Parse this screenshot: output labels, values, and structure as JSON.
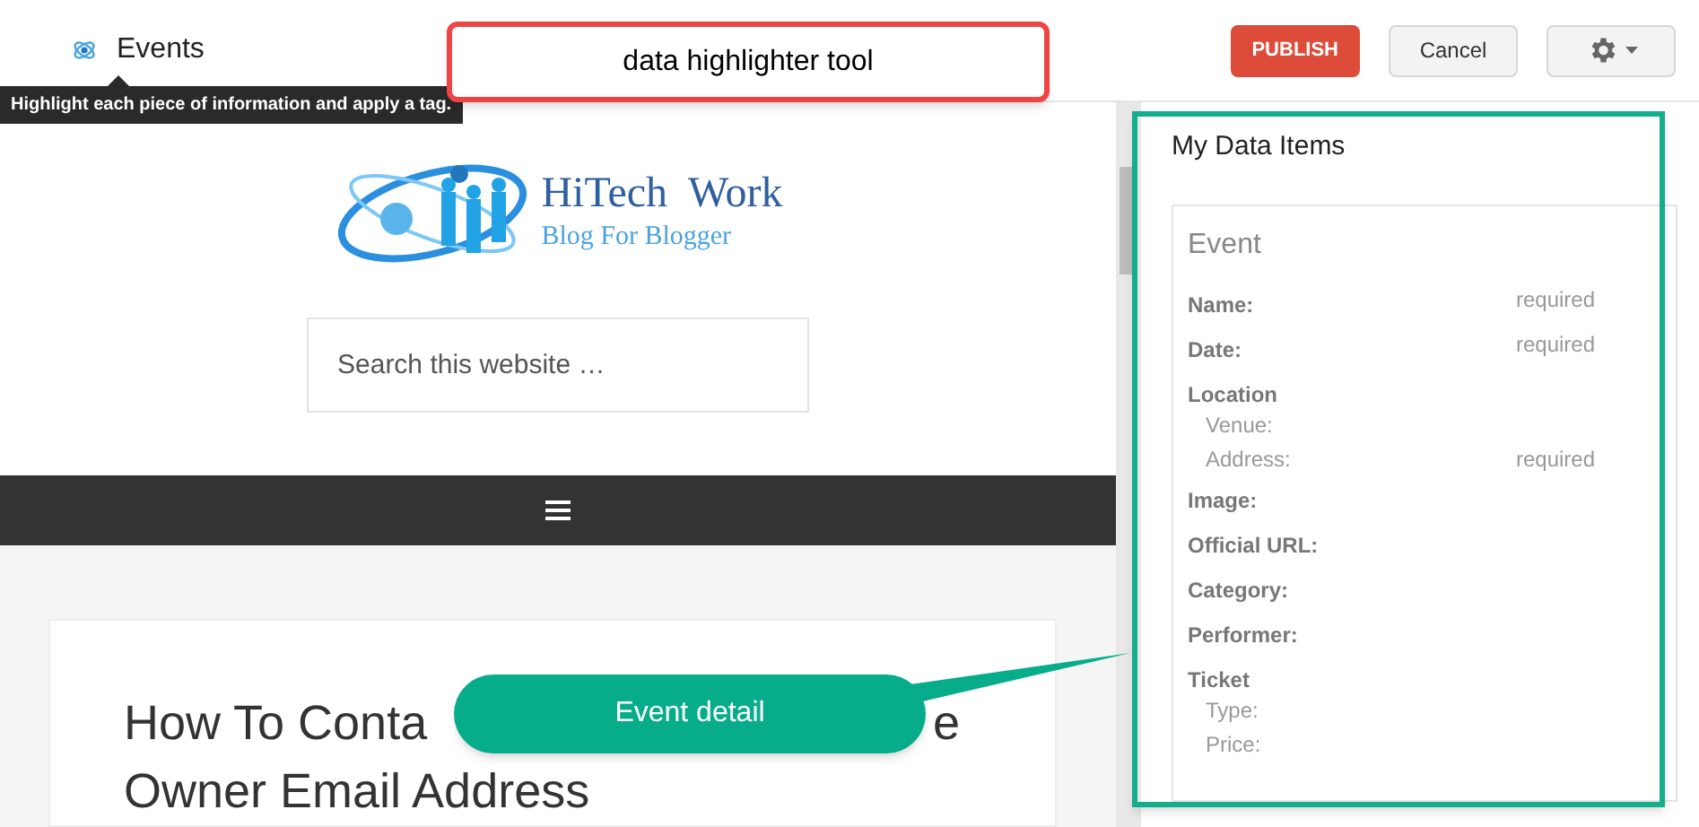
{
  "header": {
    "title": "Events",
    "tooltip": "Highlight each piece of information and apply a tag.",
    "buttons": [
      {
        "kind": "primary",
        "label": "PUBLISH"
      },
      {
        "kind": "default",
        "label": "Cancel"
      },
      {
        "kind": "settings"
      }
    ]
  },
  "page": {
    "logo": {
      "title": "HiTech  Work",
      "subtitle": "Blog For Blogger"
    },
    "search": {
      "placeholder": "Search this website …"
    },
    "article": {
      "line1_left": "How To Conta",
      "line1_right": "e",
      "line2": "Owner Email Address"
    }
  },
  "panel": {
    "heading": "My Data Items",
    "card": {
      "title": "Event",
      "fields": [
        {
          "kind": "field",
          "label": "Name:",
          "status": "required"
        },
        {
          "kind": "field",
          "label": "Date:",
          "status": "required"
        },
        {
          "kind": "group",
          "label": "Location",
          "children": [
            {
              "label": "Venue:"
            },
            {
              "label": "Address:",
              "status": "required"
            }
          ]
        },
        {
          "kind": "field",
          "label": "Image:"
        },
        {
          "kind": "field",
          "label": "Official URL:"
        },
        {
          "kind": "field",
          "label": "Category:"
        },
        {
          "kind": "field",
          "label": "Performer:"
        },
        {
          "kind": "group",
          "label": "Ticket",
          "children": [
            {
              "label": "Type:"
            },
            {
              "label": "Price:"
            }
          ]
        }
      ]
    }
  },
  "annotations": [
    {
      "kind": "box",
      "text": "data highlighter tool"
    },
    {
      "kind": "callout",
      "text": "Event detail"
    }
  ]
}
